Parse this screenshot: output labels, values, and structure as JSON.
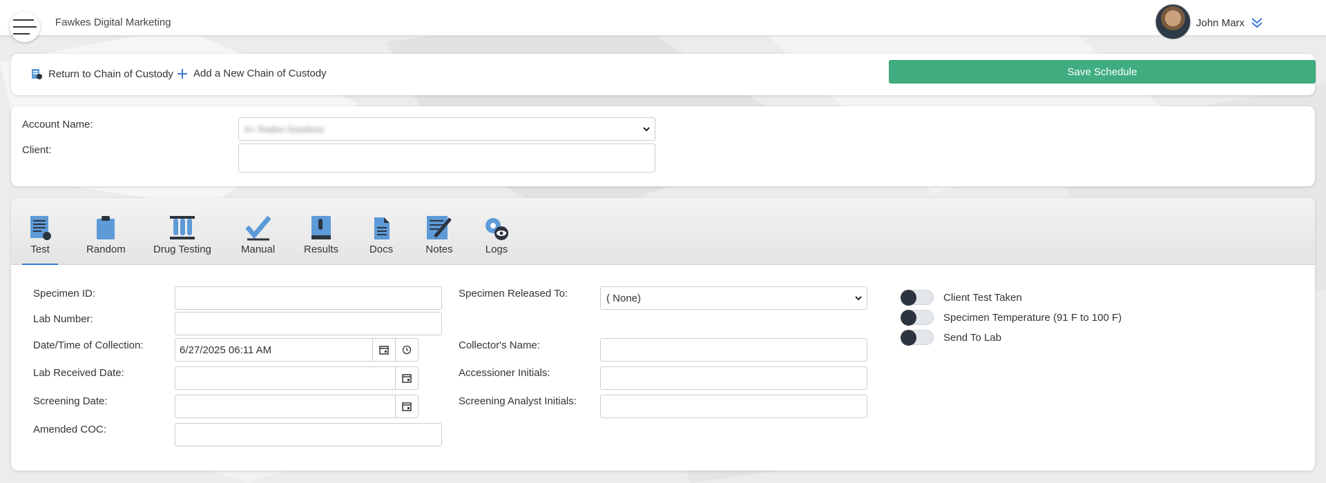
{
  "header": {
    "company": "Fawkes Digital Marketing",
    "user_name": "John Marx"
  },
  "actions": {
    "return_label": "Return to Chain of Custody",
    "add_label": "Add a New Chain of Custody",
    "save_label": "Save Schedule"
  },
  "account": {
    "account_name_label": "Account Name:",
    "account_name_value": "A+ Radon Solutions",
    "client_label": "Client:",
    "client_value": ""
  },
  "tabs": [
    {
      "label": "Test",
      "icon": "test-form-icon",
      "active": true
    },
    {
      "label": "Random",
      "icon": "clipboard-icon",
      "active": false
    },
    {
      "label": "Drug Testing",
      "icon": "test-tubes-icon",
      "active": false
    },
    {
      "label": "Manual",
      "icon": "checkmark-icon",
      "active": false
    },
    {
      "label": "Results",
      "icon": "book-icon",
      "active": false
    },
    {
      "label": "Docs",
      "icon": "documents-icon",
      "active": false
    },
    {
      "label": "Notes",
      "icon": "notepad-pencil-icon",
      "active": false
    },
    {
      "label": "Logs",
      "icon": "gear-eye-icon",
      "active": false
    }
  ],
  "form": {
    "specimen_id_label": "Specimen ID:",
    "specimen_id_value": "",
    "lab_number_label": "Lab Number:",
    "lab_number_value": "",
    "collection_label": "Date/Time of Collection:",
    "collection_value": "6/27/2025 06:11 AM",
    "lab_received_label": "Lab Received Date:",
    "lab_received_value": "",
    "screening_date_label": "Screening Date:",
    "screening_date_value": "",
    "amended_coc_label": "Amended COC:",
    "amended_coc_value": "",
    "released_to_label": "Specimen Released To:",
    "released_to_value": "( None)",
    "collector_label": "Collector's Name:",
    "collector_value": "",
    "accessioner_label": "Accessioner Initials:",
    "accessioner_value": "",
    "analyst_label": "Screening Analyst Initials:",
    "analyst_value": ""
  },
  "toggles": [
    {
      "label": "Client Test Taken",
      "on": false
    },
    {
      "label": "Specimen Temperature (91 F to 100 F)",
      "on": false
    },
    {
      "label": "Send To Lab",
      "on": false
    }
  ],
  "colors": {
    "save_button": "#40ad80",
    "tab_icon_blue": "#5d9ad8",
    "toggle_knob": "#2c3440"
  }
}
